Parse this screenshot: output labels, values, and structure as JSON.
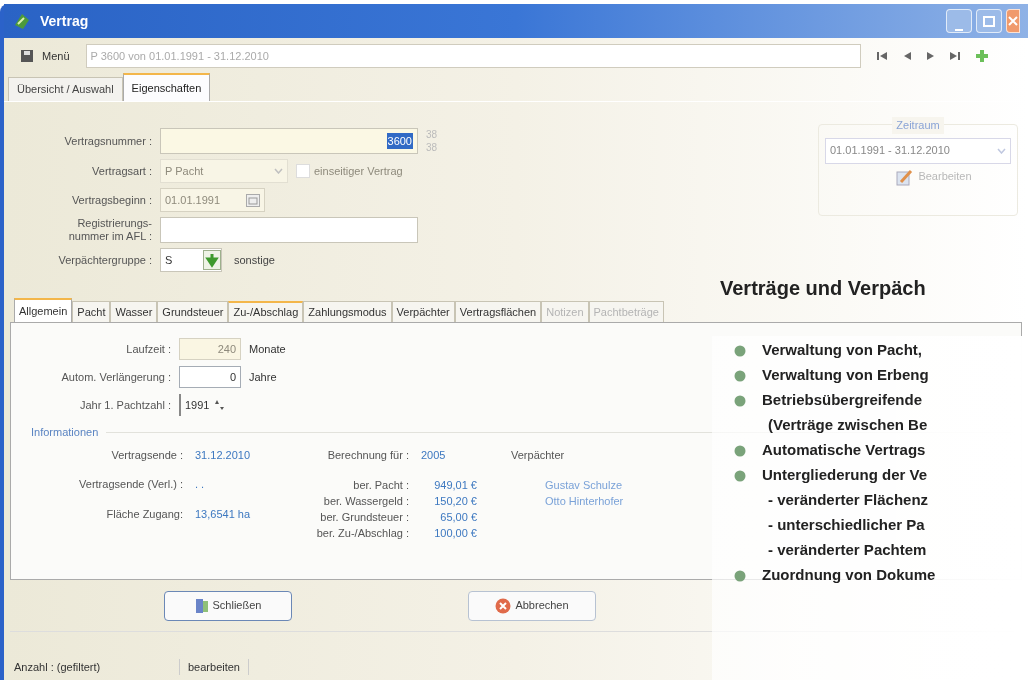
{
  "window": {
    "title": "Vertrag"
  },
  "toolbar": {
    "menu": "Menü",
    "record": "P 3600 von 01.01.1991 - 31.12.2010"
  },
  "main_tabs": [
    {
      "label": "Übersicht / Auswahl",
      "selected": false
    },
    {
      "label": "Eigenschaften",
      "selected": true
    }
  ],
  "form": {
    "contract_number": {
      "label": "Vertragsnummer :",
      "value": "3600",
      "counter": [
        "38",
        "38"
      ]
    },
    "contract_type": {
      "label": "Vertragsart :",
      "value": "P Pacht",
      "disabled": true,
      "unilateral": {
        "label": "einseitiger Vertrag",
        "checked": false,
        "disabled": true
      }
    },
    "start": {
      "label": "Vertragsbeginn :",
      "value": "01.01.1991",
      "disabled": true
    },
    "registration": {
      "label_lines": [
        "Registrierungs-",
        "nummer im AFL :"
      ]
    },
    "lessor_group": {
      "label": "Verpächtergruppe :",
      "value": "S",
      "description": "sonstige"
    }
  },
  "period": {
    "legend": "Zeitraum",
    "value": "01.01.1991 - 31.12.2010",
    "edit": "Bearbeiten",
    "disabled": true
  },
  "sub_tabs": [
    {
      "label": "Allgemein",
      "selected": true,
      "disabled": false,
      "highlighted": false
    },
    {
      "label": "Pacht",
      "selected": false,
      "disabled": false,
      "highlighted": false
    },
    {
      "label": "Wasser",
      "selected": false,
      "disabled": false,
      "highlighted": false
    },
    {
      "label": "Grundsteuer",
      "selected": false,
      "disabled": false,
      "highlighted": false
    },
    {
      "label": "Zu-/Abschlag",
      "selected": false,
      "disabled": false,
      "highlighted": true
    },
    {
      "label": "Zahlungsmodus",
      "selected": false,
      "disabled": false,
      "highlighted": false
    },
    {
      "label": "Verpächter",
      "selected": false,
      "disabled": false,
      "highlighted": false
    },
    {
      "label": "Vertragsflächen",
      "selected": false,
      "disabled": false,
      "highlighted": false
    },
    {
      "label": "Notizen",
      "selected": false,
      "disabled": true,
      "highlighted": false
    },
    {
      "label": "Pachtbeträge",
      "selected": false,
      "disabled": true,
      "highlighted": false
    }
  ],
  "general": {
    "duration": {
      "label": "Laufzeit :",
      "value": "240",
      "unit": "Monate",
      "disabled": true
    },
    "extension": {
      "label": "Autom. Verlängerung :",
      "value": "0",
      "unit": "Jahre",
      "disabled": false
    },
    "first_year": {
      "label": "Jahr 1. Pachtzahl :",
      "value": "1991"
    }
  },
  "info": {
    "title": "Informationen",
    "left": [
      {
        "label": "Vertragsende :",
        "value": "31.12.2010"
      },
      {
        "label": "Vertragsende (Verl.) :",
        "value": ". ."
      },
      {
        "label": "Fläche Zugang:",
        "value": "13,6541 ha"
      }
    ],
    "calc_label": "Berechnung für :",
    "calc_year": "2005",
    "amounts": [
      {
        "label": "ber. Pacht :",
        "value": "949,01 €"
      },
      {
        "label": "ber. Wassergeld :",
        "value": "150,20 €"
      },
      {
        "label": "ber. Grundsteuer :",
        "value": "65,00 €"
      },
      {
        "label": "ber. Zu-/Abschlag :",
        "value": "100,00 €"
      }
    ],
    "lessors_title": "Verpächter",
    "lessors": [
      "Gustav Schulze",
      "Otto Hinterhofer"
    ]
  },
  "buttons": [
    {
      "label": "Schließen",
      "kind": "close"
    },
    {
      "label": "Abbrechen",
      "kind": "cancel"
    }
  ],
  "status_bar": [
    "Anzahl : (gefiltert)",
    "bearbeiten"
  ],
  "overlay": {
    "title": "Verträge und Verpäch",
    "items": [
      {
        "kind": "bullet",
        "text": "Verwaltung von Pacht,"
      },
      {
        "kind": "bullet",
        "text": "Verwaltung von Erbeng"
      },
      {
        "kind": "bullet",
        "text": "Betriebsübergreifende"
      },
      {
        "kind": "continuation",
        "text": "(Verträge zwischen Be"
      },
      {
        "kind": "bullet",
        "text": "Automatische Vertrags"
      },
      {
        "kind": "bullet",
        "text": "Untergliederung der Ve"
      },
      {
        "kind": "sub",
        "text": "- veränderter Flächenz"
      },
      {
        "kind": "sub",
        "text": "- unterschiedlicher Pa"
      },
      {
        "kind": "sub",
        "text": "- veränderter Pachtem"
      },
      {
        "kind": "bullet",
        "text": "Zuordnung von Dokume"
      }
    ]
  }
}
